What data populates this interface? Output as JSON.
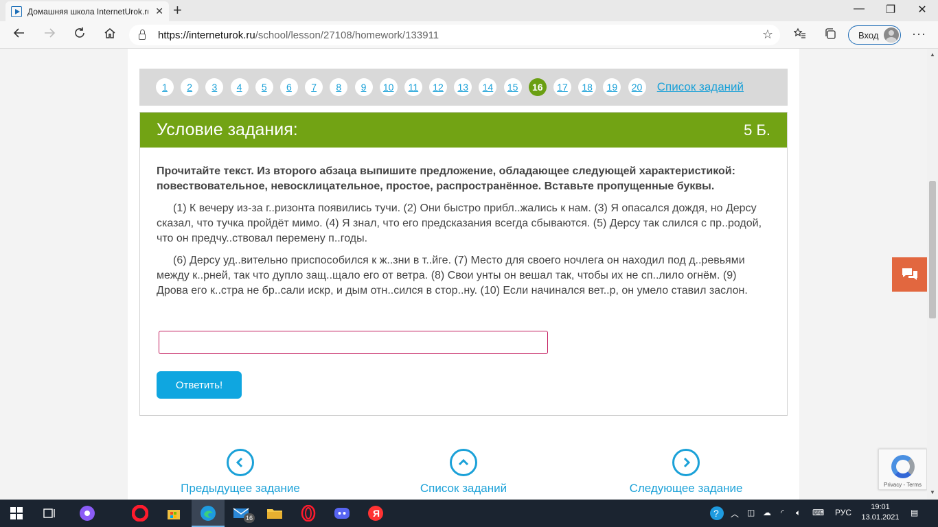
{
  "browser": {
    "tab_title": "Домашняя школа InternetUrok.ru",
    "tab_close": "✕",
    "new_tab": "+",
    "minimize": "—",
    "restore": "❐",
    "close": "✕",
    "url_host": "https://interneturok.ru",
    "url_path": "/school/lesson/27108/homework/133911",
    "signin_label": "Вход"
  },
  "pager": {
    "pages": [
      "1",
      "2",
      "3",
      "4",
      "5",
      "6",
      "7",
      "8",
      "9",
      "10",
      "11",
      "12",
      "13",
      "14",
      "15",
      "16",
      "17",
      "18",
      "19",
      "20"
    ],
    "active": "16",
    "list_link": "Список заданий"
  },
  "task": {
    "title": "Условие задания:",
    "points": "5 Б.",
    "instruction": "Прочитайте текст. Из второго абзаца выпишите предложение, обладающее следующей характеристикой: повествовательное, невосклицательное, простое, распространённое. Вставьте пропущенные буквы.",
    "paragraph1": "(1) К вечеру из-за г..ризонта появились тучи. (2) Они быстро прибл..жались к нам. (3) Я опасался дождя, но Дерсу сказал, что тучка пройдёт мимо. (4) Я знал, что его предсказания всегда сбываются. (5) Дерсу так слился с пр..родой, что он предчу..ствовал перемену п..годы.",
    "paragraph2": "(6) Дерсу уд..вительно приспособился к ж..зни в т..йге. (7) Место для своего ночлега он находил под д..ревьями между к..рней, так что дупло защ..щало его от ветра. (8) Свои унты он вешал так, чтобы их не сп..лило огнём. (9) Дрова его к..стра не бр..сали искр, и дым отн..сился в стор..ну. (10) Если начинался вет..р, он умело ставил заслон.",
    "answer_value": "",
    "submit_label": "Ответить!"
  },
  "bottom_nav": {
    "prev": "Предыдущее задание",
    "list": "Список заданий",
    "next": "Следующее задание"
  },
  "recaptcha": {
    "text": "Privacy - Terms"
  },
  "taskbar": {
    "mail_badge": "16",
    "lang": "РУС",
    "time": "19:01",
    "date": "13.01.2021"
  },
  "colors": {
    "accent_green": "#72a314",
    "link_blue": "#1ba1d8",
    "button_blue": "#0fa6e0",
    "chat_orange": "#e2673f",
    "input_border": "#c2185b"
  }
}
